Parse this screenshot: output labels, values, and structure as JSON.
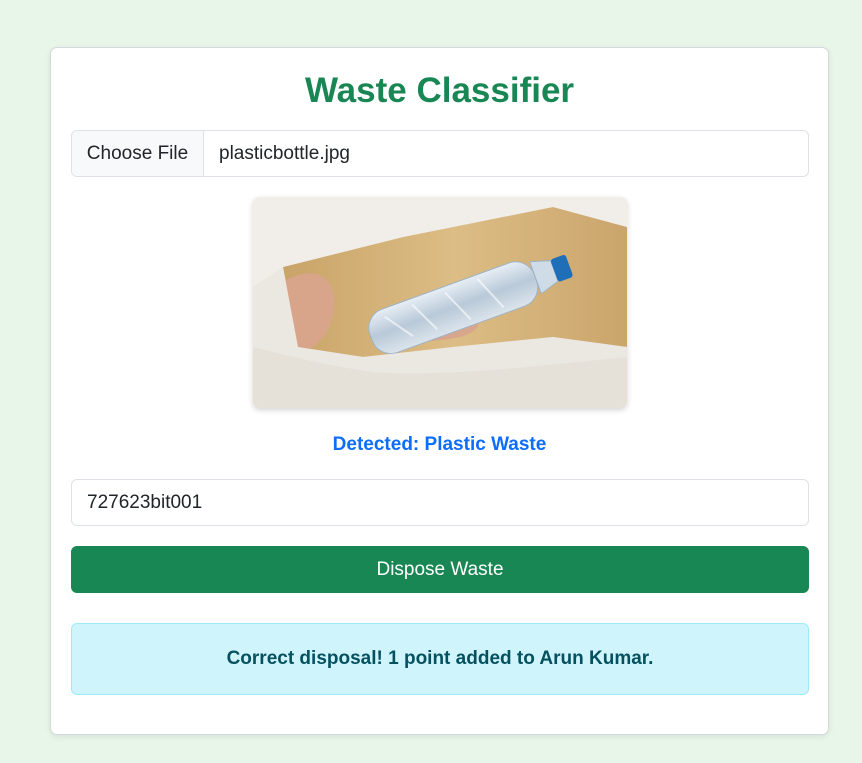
{
  "app": {
    "title": "Waste Classifier"
  },
  "file_input": {
    "button_label": "Choose File",
    "file_name": "plasticbottle.jpg"
  },
  "preview": {
    "alt": "plastic bottle"
  },
  "result": {
    "detected_text": "Detected: Plastic Waste"
  },
  "id_field": {
    "value": "727623bit001"
  },
  "actions": {
    "dispose_label": "Dispose Waste"
  },
  "alert": {
    "message": "Correct disposal! 1 point added to Arun Kumar."
  },
  "colors": {
    "page_background": "#e8f5e9",
    "title": "#198754",
    "primary_button": "#198754",
    "detected": "#0d6efd",
    "alert_background": "#cff4fc",
    "alert_text": "#055160"
  }
}
